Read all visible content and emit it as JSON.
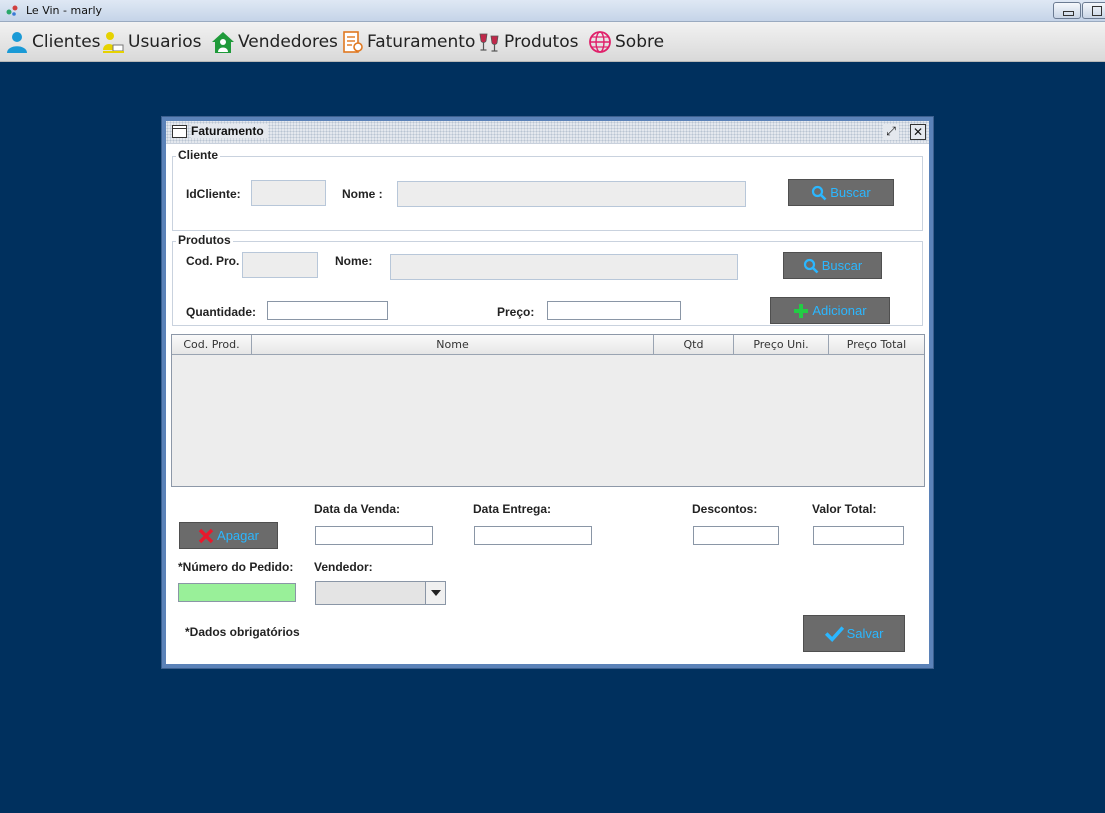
{
  "window": {
    "title": "Le Vin - marly"
  },
  "menu": {
    "items": [
      {
        "label": "Clientes",
        "icon": "person-icon"
      },
      {
        "label": "Usuarios",
        "icon": "user-laptop-icon"
      },
      {
        "label": "Vendedores",
        "icon": "house-person-icon"
      },
      {
        "label": "Faturamento",
        "icon": "invoice-icon"
      },
      {
        "label": "Produtos",
        "icon": "wine-glasses-icon"
      },
      {
        "label": "Sobre",
        "icon": "globe-hand-icon"
      }
    ]
  },
  "frame": {
    "title": "Faturamento",
    "cliente": {
      "legend": "Cliente",
      "id_label": "IdCliente:",
      "id_value": "",
      "nome_label": "Nome :",
      "nome_value": "",
      "buscar_label": "Buscar"
    },
    "produtos": {
      "legend": "Produtos",
      "cod_label": "Cod. Pro.",
      "cod_value": "",
      "nome_label": "Nome:",
      "nome_value": "",
      "buscar_label": "Buscar",
      "quantidade_label": "Quantidade:",
      "quantidade_value": "",
      "preco_label": "Preço:",
      "preco_value": "",
      "adicionar_label": "Adicionar"
    },
    "table": {
      "columns": [
        "Cod. Prod.",
        "Nome",
        "Qtd",
        "Preço Uni.",
        "Preço Total"
      ],
      "rows": []
    },
    "footer": {
      "apagar_label": "Apagar",
      "data_venda_label": "Data da Venda:",
      "data_venda_value": "",
      "data_entrega_label": "Data Entrega:",
      "data_entrega_value": "",
      "descontos_label": "Descontos:",
      "descontos_value": "",
      "valor_total_label": "Valor Total:",
      "valor_total_value": "",
      "numero_pedido_label": "*Número do Pedido:",
      "numero_pedido_value": "",
      "vendedor_label": "Vendedor:",
      "vendedor_value": "",
      "obrigatorios_label": "*Dados obrigatórios",
      "salvar_label": "Salvar"
    }
  },
  "colors": {
    "desktop": "#00305e",
    "button_bg": "#6b6b6b",
    "button_text": "#2bb7ff",
    "required_field": "#99f099"
  }
}
